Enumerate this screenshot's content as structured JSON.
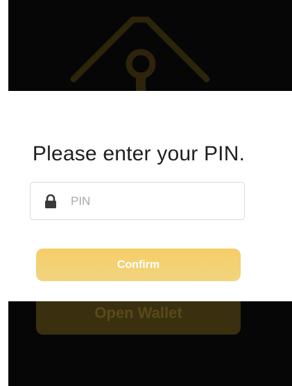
{
  "background": {
    "color": "#060606",
    "logo_icon": "tag-key-logo",
    "open_wallet_label": "Open Wallet",
    "open_wallet_color": "#3a2f0e"
  },
  "modal": {
    "title": "Please enter your PIN.",
    "pin_field": {
      "icon": "lock-icon",
      "placeholder": "PIN",
      "value": ""
    },
    "confirm_label": "Confirm",
    "accent_color": "#f6cd68"
  }
}
